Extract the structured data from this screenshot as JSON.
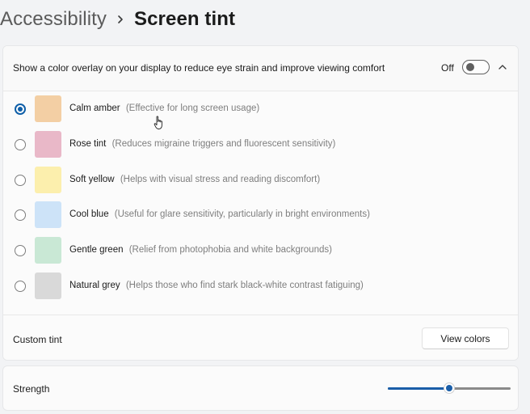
{
  "breadcrumb": {
    "parent": "Accessibility",
    "current": "Screen tint"
  },
  "overlay": {
    "description": "Show a color overlay on your display to reduce eye strain and improve viewing comfort",
    "toggle_state": "Off",
    "toggle_on": false,
    "expanded": true
  },
  "tints": [
    {
      "name": "Calm amber",
      "description": "(Effective for long screen usage)",
      "color": "#f3cfa4",
      "selected": true
    },
    {
      "name": "Rose tint",
      "description": "(Reduces migraine triggers and fluorescent sensitivity)",
      "color": "#e9b8c8",
      "selected": false
    },
    {
      "name": "Soft yellow",
      "description": "(Helps with visual stress and reading discomfort)",
      "color": "#fcefad",
      "selected": false
    },
    {
      "name": "Cool blue",
      "description": "(Useful for glare sensitivity, particularly in bright environments)",
      "color": "#cde3f8",
      "selected": false
    },
    {
      "name": "Gentle green",
      "description": "(Relief from photophobia and white backgrounds)",
      "color": "#c9e8d5",
      "selected": false
    },
    {
      "name": "Natural grey",
      "description": "(Helps those who find stark black-white contrast fatiguing)",
      "color": "#d9d9d9",
      "selected": false
    }
  ],
  "custom_tint": {
    "label": "Custom tint",
    "button_label": "View colors"
  },
  "strength": {
    "label": "Strength",
    "value_fraction": 0.5
  },
  "colors": {
    "accent": "#0f5fa8",
    "page_background": "#f2f3f5",
    "card_background": "#fbfbfb"
  },
  "icons": {
    "breadcrumb_separator": "chevron-right-icon",
    "collapse": "chevron-up-icon",
    "cursor": "hand-pointer-icon"
  }
}
